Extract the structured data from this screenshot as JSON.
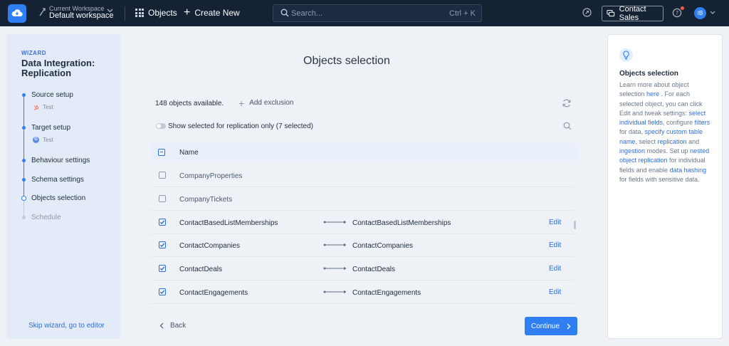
{
  "topbar": {
    "workspace_caption": "Current Workspace",
    "workspace_name": "Default workspace",
    "objects_label": "Objects",
    "create_label": "Create New",
    "search_placeholder": "Search...",
    "search_shortcut": "Ctrl + K",
    "contact_sales_label": "Contact Sales",
    "avatar_initials": "IB"
  },
  "wizard": {
    "label": "WIZARD",
    "title": "Data Integration: Replication",
    "steps": [
      {
        "label": "Source setup",
        "sub": "Test"
      },
      {
        "label": "Target setup",
        "sub": "Test"
      },
      {
        "label": "Behaviour settings"
      },
      {
        "label": "Schema settings"
      },
      {
        "label": "Objects selection"
      },
      {
        "label": "Schedule"
      }
    ],
    "skip_label": "Skip wizard, go to editor"
  },
  "main": {
    "title": "Objects selection",
    "available_text": "148 objects available.",
    "add_exclusion_label": "Add exclusion",
    "toggle_label": "Show selected for replication only (7 selected)",
    "header_name": "Name",
    "rows": [
      {
        "source": "CompanyProperties",
        "target": "",
        "edit": ""
      },
      {
        "source": "CompanyTickets",
        "target": "",
        "edit": ""
      },
      {
        "source": "ContactBasedListMemberships",
        "target": "ContactBasedListMemberships",
        "edit": "Edit"
      },
      {
        "source": "ContactCompanies",
        "target": "ContactCompanies",
        "edit": "Edit"
      },
      {
        "source": "ContactDeals",
        "target": "ContactDeals",
        "edit": "Edit"
      },
      {
        "source": "ContactEngagements",
        "target": "ContactEngagements",
        "edit": "Edit"
      }
    ],
    "back_label": "Back",
    "continue_label": "Continue"
  },
  "help": {
    "title": "Objects selection",
    "p1": "Learn more about object selection ",
    "here": "here",
    "p2": " . For each selected object, you can click Edit and tweak settings: ",
    "l1": "select individual fields",
    "p3": ", configure ",
    "l2": "filters",
    "p4": " for data, ",
    "l3": "specify custom table name",
    "p5": ", select ",
    "l4": "replication",
    "p6": " and ",
    "l5": "ingestion",
    "p7": " modes. Set up ",
    "l6": "nested object replication",
    "p8": " for individual fields and enable ",
    "l7": "data hashing",
    "p9": " for fields with sensitive data."
  },
  "colors": {
    "topbar": "#142234",
    "accent": "#2f7ff2",
    "link": "#2f6fd9",
    "wizard_bg": "#e3ebf9"
  }
}
